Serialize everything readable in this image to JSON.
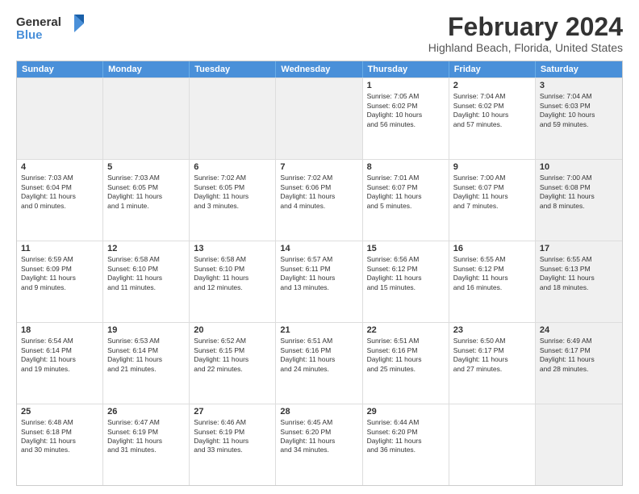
{
  "logo": {
    "line1": "General",
    "line2": "Blue"
  },
  "title": "February 2024",
  "subtitle": "Highland Beach, Florida, United States",
  "header_days": [
    "Sunday",
    "Monday",
    "Tuesday",
    "Wednesday",
    "Thursday",
    "Friday",
    "Saturday"
  ],
  "weeks": [
    [
      {
        "day": "",
        "info": "",
        "shaded": true
      },
      {
        "day": "",
        "info": "",
        "shaded": true
      },
      {
        "day": "",
        "info": "",
        "shaded": true
      },
      {
        "day": "",
        "info": "",
        "shaded": true
      },
      {
        "day": "1",
        "info": "Sunrise: 7:05 AM\nSunset: 6:02 PM\nDaylight: 10 hours\nand 56 minutes.",
        "shaded": false
      },
      {
        "day": "2",
        "info": "Sunrise: 7:04 AM\nSunset: 6:02 PM\nDaylight: 10 hours\nand 57 minutes.",
        "shaded": false
      },
      {
        "day": "3",
        "info": "Sunrise: 7:04 AM\nSunset: 6:03 PM\nDaylight: 10 hours\nand 59 minutes.",
        "shaded": true
      }
    ],
    [
      {
        "day": "4",
        "info": "Sunrise: 7:03 AM\nSunset: 6:04 PM\nDaylight: 11 hours\nand 0 minutes.",
        "shaded": false
      },
      {
        "day": "5",
        "info": "Sunrise: 7:03 AM\nSunset: 6:05 PM\nDaylight: 11 hours\nand 1 minute.",
        "shaded": false
      },
      {
        "day": "6",
        "info": "Sunrise: 7:02 AM\nSunset: 6:05 PM\nDaylight: 11 hours\nand 3 minutes.",
        "shaded": false
      },
      {
        "day": "7",
        "info": "Sunrise: 7:02 AM\nSunset: 6:06 PM\nDaylight: 11 hours\nand 4 minutes.",
        "shaded": false
      },
      {
        "day": "8",
        "info": "Sunrise: 7:01 AM\nSunset: 6:07 PM\nDaylight: 11 hours\nand 5 minutes.",
        "shaded": false
      },
      {
        "day": "9",
        "info": "Sunrise: 7:00 AM\nSunset: 6:07 PM\nDaylight: 11 hours\nand 7 minutes.",
        "shaded": false
      },
      {
        "day": "10",
        "info": "Sunrise: 7:00 AM\nSunset: 6:08 PM\nDaylight: 11 hours\nand 8 minutes.",
        "shaded": true
      }
    ],
    [
      {
        "day": "11",
        "info": "Sunrise: 6:59 AM\nSunset: 6:09 PM\nDaylight: 11 hours\nand 9 minutes.",
        "shaded": false
      },
      {
        "day": "12",
        "info": "Sunrise: 6:58 AM\nSunset: 6:10 PM\nDaylight: 11 hours\nand 11 minutes.",
        "shaded": false
      },
      {
        "day": "13",
        "info": "Sunrise: 6:58 AM\nSunset: 6:10 PM\nDaylight: 11 hours\nand 12 minutes.",
        "shaded": false
      },
      {
        "day": "14",
        "info": "Sunrise: 6:57 AM\nSunset: 6:11 PM\nDaylight: 11 hours\nand 13 minutes.",
        "shaded": false
      },
      {
        "day": "15",
        "info": "Sunrise: 6:56 AM\nSunset: 6:12 PM\nDaylight: 11 hours\nand 15 minutes.",
        "shaded": false
      },
      {
        "day": "16",
        "info": "Sunrise: 6:55 AM\nSunset: 6:12 PM\nDaylight: 11 hours\nand 16 minutes.",
        "shaded": false
      },
      {
        "day": "17",
        "info": "Sunrise: 6:55 AM\nSunset: 6:13 PM\nDaylight: 11 hours\nand 18 minutes.",
        "shaded": true
      }
    ],
    [
      {
        "day": "18",
        "info": "Sunrise: 6:54 AM\nSunset: 6:14 PM\nDaylight: 11 hours\nand 19 minutes.",
        "shaded": false
      },
      {
        "day": "19",
        "info": "Sunrise: 6:53 AM\nSunset: 6:14 PM\nDaylight: 11 hours\nand 21 minutes.",
        "shaded": false
      },
      {
        "day": "20",
        "info": "Sunrise: 6:52 AM\nSunset: 6:15 PM\nDaylight: 11 hours\nand 22 minutes.",
        "shaded": false
      },
      {
        "day": "21",
        "info": "Sunrise: 6:51 AM\nSunset: 6:16 PM\nDaylight: 11 hours\nand 24 minutes.",
        "shaded": false
      },
      {
        "day": "22",
        "info": "Sunrise: 6:51 AM\nSunset: 6:16 PM\nDaylight: 11 hours\nand 25 minutes.",
        "shaded": false
      },
      {
        "day": "23",
        "info": "Sunrise: 6:50 AM\nSunset: 6:17 PM\nDaylight: 11 hours\nand 27 minutes.",
        "shaded": false
      },
      {
        "day": "24",
        "info": "Sunrise: 6:49 AM\nSunset: 6:17 PM\nDaylight: 11 hours\nand 28 minutes.",
        "shaded": true
      }
    ],
    [
      {
        "day": "25",
        "info": "Sunrise: 6:48 AM\nSunset: 6:18 PM\nDaylight: 11 hours\nand 30 minutes.",
        "shaded": false
      },
      {
        "day": "26",
        "info": "Sunrise: 6:47 AM\nSunset: 6:19 PM\nDaylight: 11 hours\nand 31 minutes.",
        "shaded": false
      },
      {
        "day": "27",
        "info": "Sunrise: 6:46 AM\nSunset: 6:19 PM\nDaylight: 11 hours\nand 33 minutes.",
        "shaded": false
      },
      {
        "day": "28",
        "info": "Sunrise: 6:45 AM\nSunset: 6:20 PM\nDaylight: 11 hours\nand 34 minutes.",
        "shaded": false
      },
      {
        "day": "29",
        "info": "Sunrise: 6:44 AM\nSunset: 6:20 PM\nDaylight: 11 hours\nand 36 minutes.",
        "shaded": false
      },
      {
        "day": "",
        "info": "",
        "shaded": false
      },
      {
        "day": "",
        "info": "",
        "shaded": true
      }
    ]
  ]
}
